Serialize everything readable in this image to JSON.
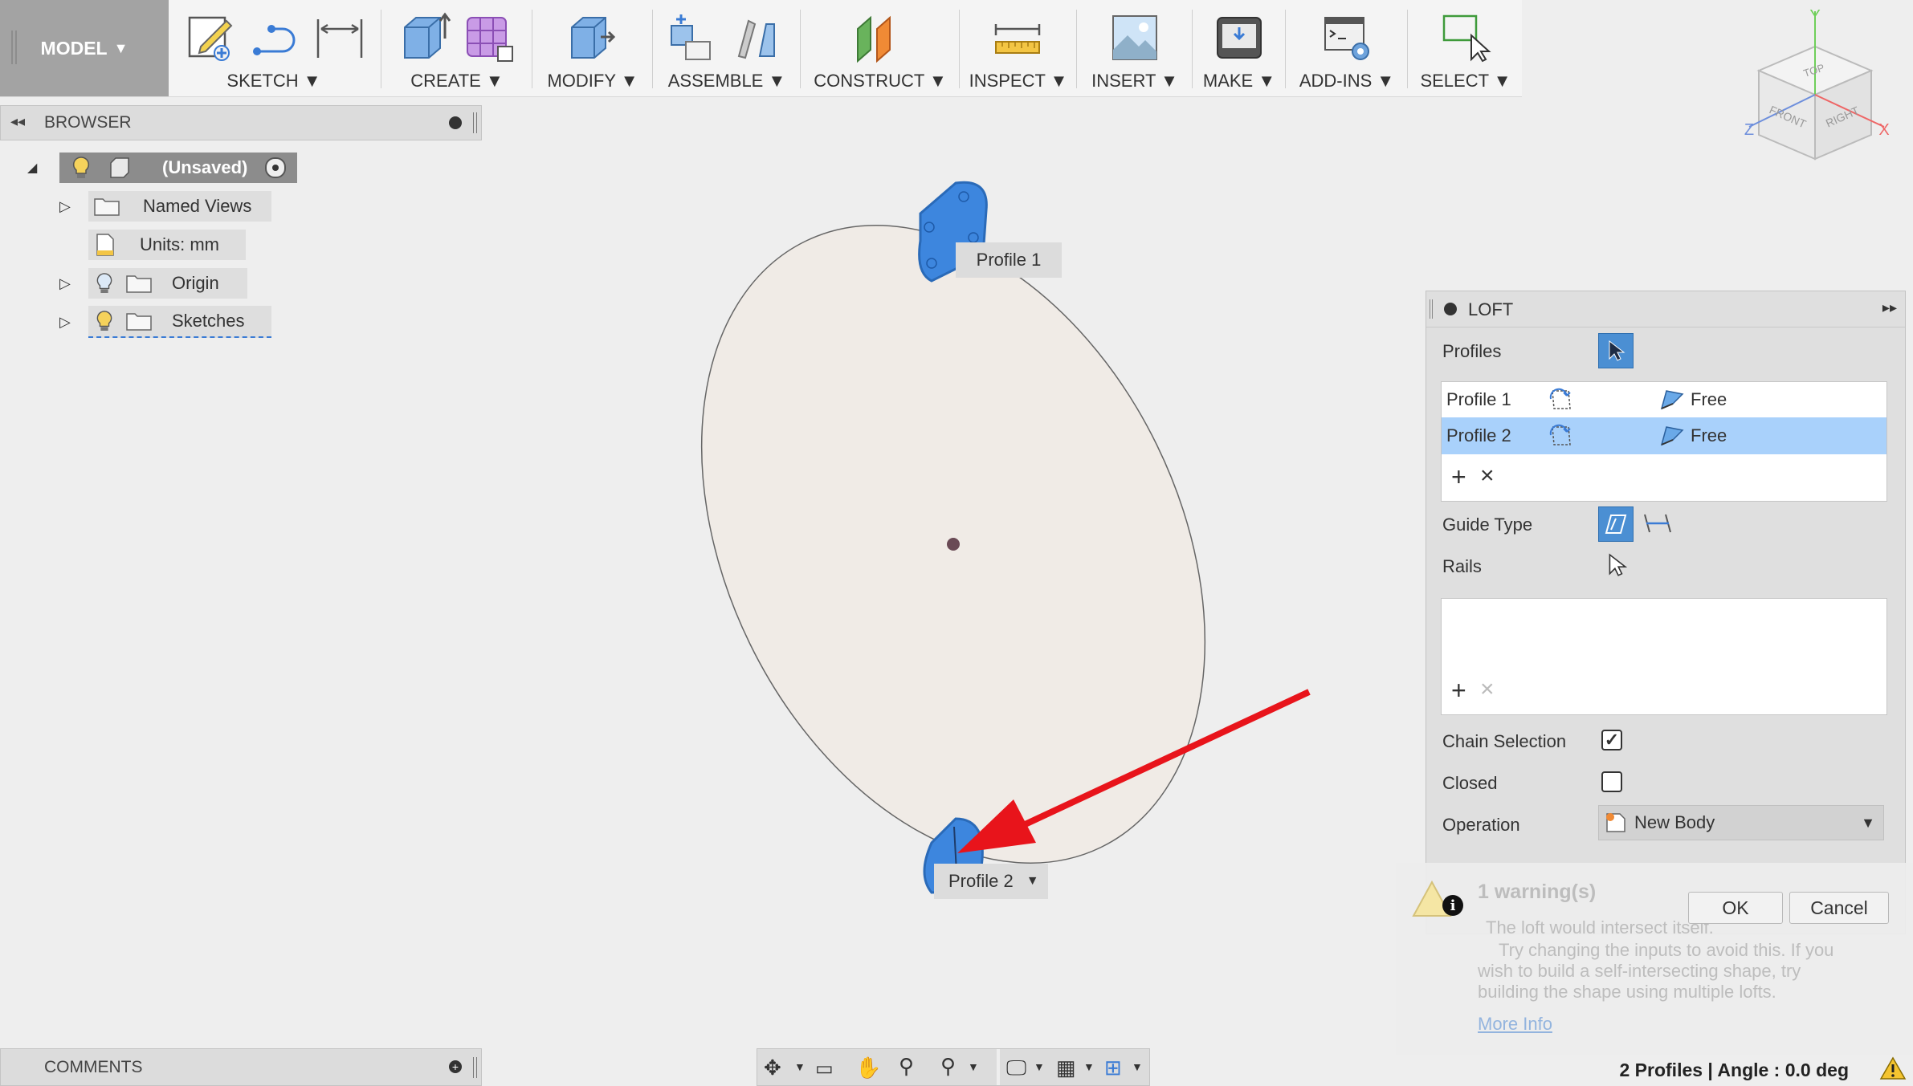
{
  "toolbar": {
    "model_label": "MODEL",
    "groups": [
      {
        "label": "SKETCH"
      },
      {
        "label": "CREATE"
      },
      {
        "label": "MODIFY"
      },
      {
        "label": "ASSEMBLE"
      },
      {
        "label": "CONSTRUCT"
      },
      {
        "label": "INSPECT"
      },
      {
        "label": "INSERT"
      },
      {
        "label": "MAKE"
      },
      {
        "label": "ADD-INS"
      },
      {
        "label": "SELECT"
      }
    ]
  },
  "browser": {
    "title": "BROWSER",
    "nodes": [
      {
        "label": "(Unsaved)"
      },
      {
        "label": "Named Views"
      },
      {
        "label": "Units: mm"
      },
      {
        "label": "Origin"
      },
      {
        "label": "Sketches"
      }
    ]
  },
  "comments": {
    "title": "COMMENTS"
  },
  "viewcube": {
    "top": "TOP",
    "front": "FRONT",
    "right": "RIGHT",
    "x": "X",
    "y": "Y",
    "z": "Z"
  },
  "canvas": {
    "profile1_label": "Profile 1",
    "profile2_label": "Profile 2"
  },
  "loft": {
    "title": "LOFT",
    "profiles_label": "Profiles",
    "profiles": [
      {
        "name": "Profile 1",
        "end": "Free",
        "selected": false
      },
      {
        "name": "Profile 2",
        "end": "Free",
        "selected": true
      }
    ],
    "add": "+",
    "remove": "×",
    "guide_type_label": "Guide Type",
    "rails_label": "Rails",
    "chain_selection_label": "Chain Selection",
    "chain_selection_checked": true,
    "closed_label": "Closed",
    "closed_checked": false,
    "operation_label": "Operation",
    "operation_value": "New Body",
    "ok": "OK",
    "cancel": "Cancel"
  },
  "warning": {
    "title": "1 warning(s)",
    "line1": "The loft would intersect itself.",
    "body_line1": "Try changing the inputs to avoid this. If you",
    "body_line2": "wish to build a self-intersecting shape, try",
    "body_line3": "building the shape using multiple lofts.",
    "link": "More Info"
  },
  "status": {
    "text": "2 Profiles | Angle : 0.0 deg"
  },
  "colors": {
    "accent_blue": "#3d86de",
    "selection_row": "#a9d1fb",
    "arrow_red": "#e8141b",
    "ellipse_fill": "#f0ebe6"
  }
}
